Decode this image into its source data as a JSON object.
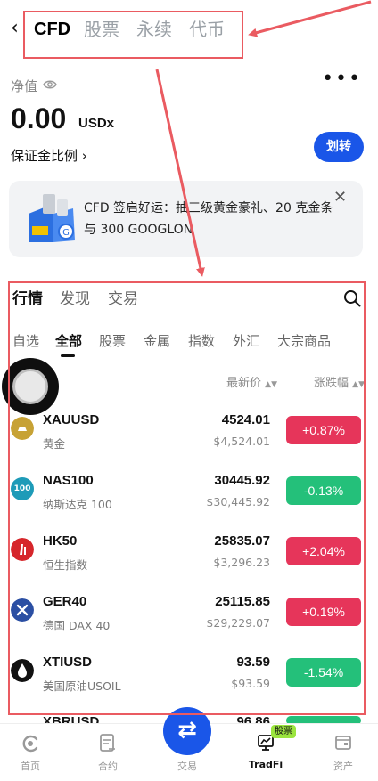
{
  "header": {
    "tabs": [
      {
        "label": "CFD"
      },
      {
        "label": "股票"
      },
      {
        "label": "永续"
      },
      {
        "label": "代币"
      }
    ]
  },
  "account": {
    "net_label": "净值",
    "net_value": "0.00",
    "net_unit": "USDx",
    "margin_ratio_label": "保证金比例",
    "transfer_label": "划转"
  },
  "banner": {
    "text": "CFD 签启好运：抽三级黄金豪礼、20 克金条与 300 GOOGLON"
  },
  "market": {
    "tabs": [
      {
        "label": "行情"
      },
      {
        "label": "发现"
      },
      {
        "label": "交易"
      }
    ],
    "categories": [
      {
        "label": "自选"
      },
      {
        "label": "全部"
      },
      {
        "label": "股票"
      },
      {
        "label": "金属"
      },
      {
        "label": "指数"
      },
      {
        "label": "外汇"
      },
      {
        "label": "大宗商品"
      }
    ],
    "col_price": "最新价",
    "col_change": "涨跌幅",
    "rows": [
      {
        "symbol": "XAUUSD",
        "name": "黄金",
        "price": "4524.01",
        "usd": "$4,524.01",
        "change": "+0.87%"
      },
      {
        "symbol": "NAS100",
        "name": "纳斯达克 100",
        "price": "30445.92",
        "usd": "$30,445.92",
        "change": "-0.13%",
        "icon_text": "100"
      },
      {
        "symbol": "HK50",
        "name": "恒生指数",
        "price": "25835.07",
        "usd": "$3,296.23",
        "change": "+2.04%"
      },
      {
        "symbol": "GER40",
        "name": "德国 DAX 40",
        "price": "25115.85",
        "usd": "$29,229.07",
        "change": "+0.19%"
      },
      {
        "symbol": "XTIUSD",
        "name": "美国原油USOIL",
        "price": "93.59",
        "usd": "$93.59",
        "change": "-1.54%"
      },
      {
        "symbol": "XBRUSD",
        "price": "96.86"
      }
    ]
  },
  "bottom_nav": {
    "items": [
      {
        "label": "首页"
      },
      {
        "label": "合约"
      },
      {
        "label": "交易"
      },
      {
        "label": "TradFi"
      },
      {
        "label": "资产"
      }
    ],
    "badge": "股票"
  },
  "colors": {
    "accent": "#1a56e8",
    "up": "#e6355a",
    "down": "#24c07a",
    "annotation": "#ea5b61"
  }
}
